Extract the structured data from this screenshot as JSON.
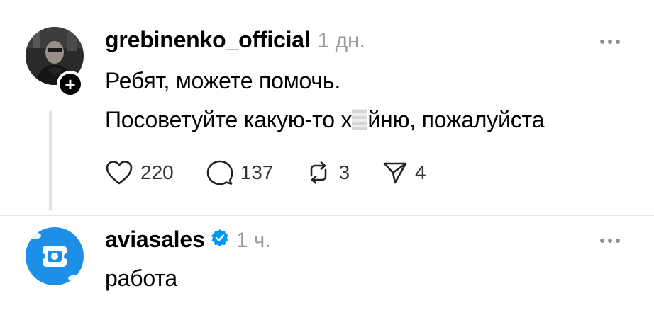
{
  "post1": {
    "username": "grebinenko_official",
    "time": "1 дн.",
    "line1": "Ребят, можете помочь.",
    "line2_before": "Посоветуйте какую-то х",
    "line2_after": "йню, пожалуйста",
    "likes": "220",
    "comments": "137",
    "reposts": "3",
    "shares": "4",
    "follow_icon": "plus-icon"
  },
  "post2": {
    "username": "aviasales",
    "time": "1 ч.",
    "text": "работа",
    "verified_color": "#0095f6",
    "avatar_color": "#1e8fe6"
  }
}
